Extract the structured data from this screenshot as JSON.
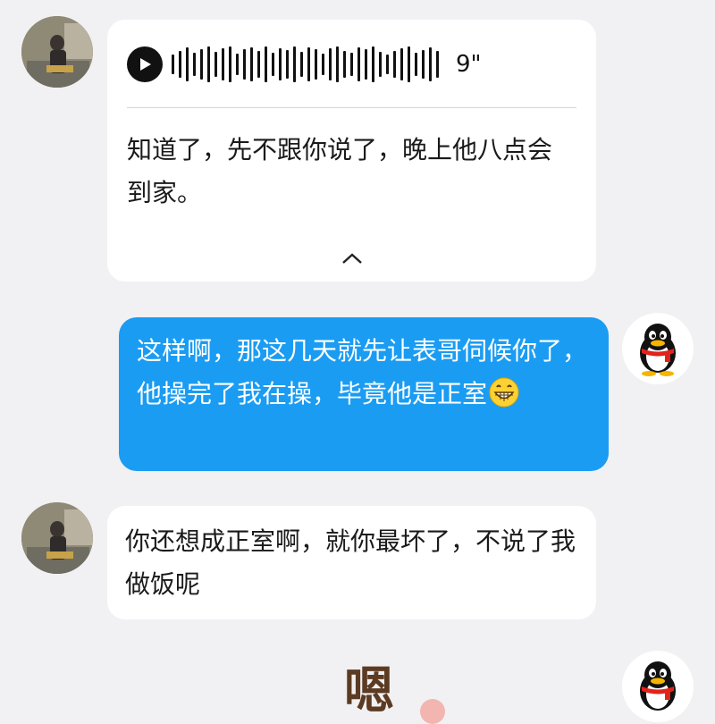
{
  "messages": [
    {
      "from": "contact",
      "type": "voice",
      "voice": {
        "duration": "9\"",
        "play_icon": "play-icon"
      },
      "transcript": "知道了，先不跟你说了，晚上他八点会到家。",
      "collapse_icon": "chevron-up-icon"
    },
    {
      "from": "me",
      "type": "text",
      "text": "这样啊，那这几天就先让表哥伺候你了，他操完了我在操，毕竟他是正室",
      "emoji": "grinning-face-emoji"
    },
    {
      "from": "contact",
      "type": "text",
      "text": "你还想成正室啊，就你最坏了，不说了我做饭呢"
    },
    {
      "from": "me",
      "type": "sticker",
      "sticker_text": "嗯"
    }
  ],
  "colors": {
    "background": "#f1f1f3",
    "incoming_bubble": "#ffffff",
    "outgoing_bubble": "#1a9cf3"
  }
}
